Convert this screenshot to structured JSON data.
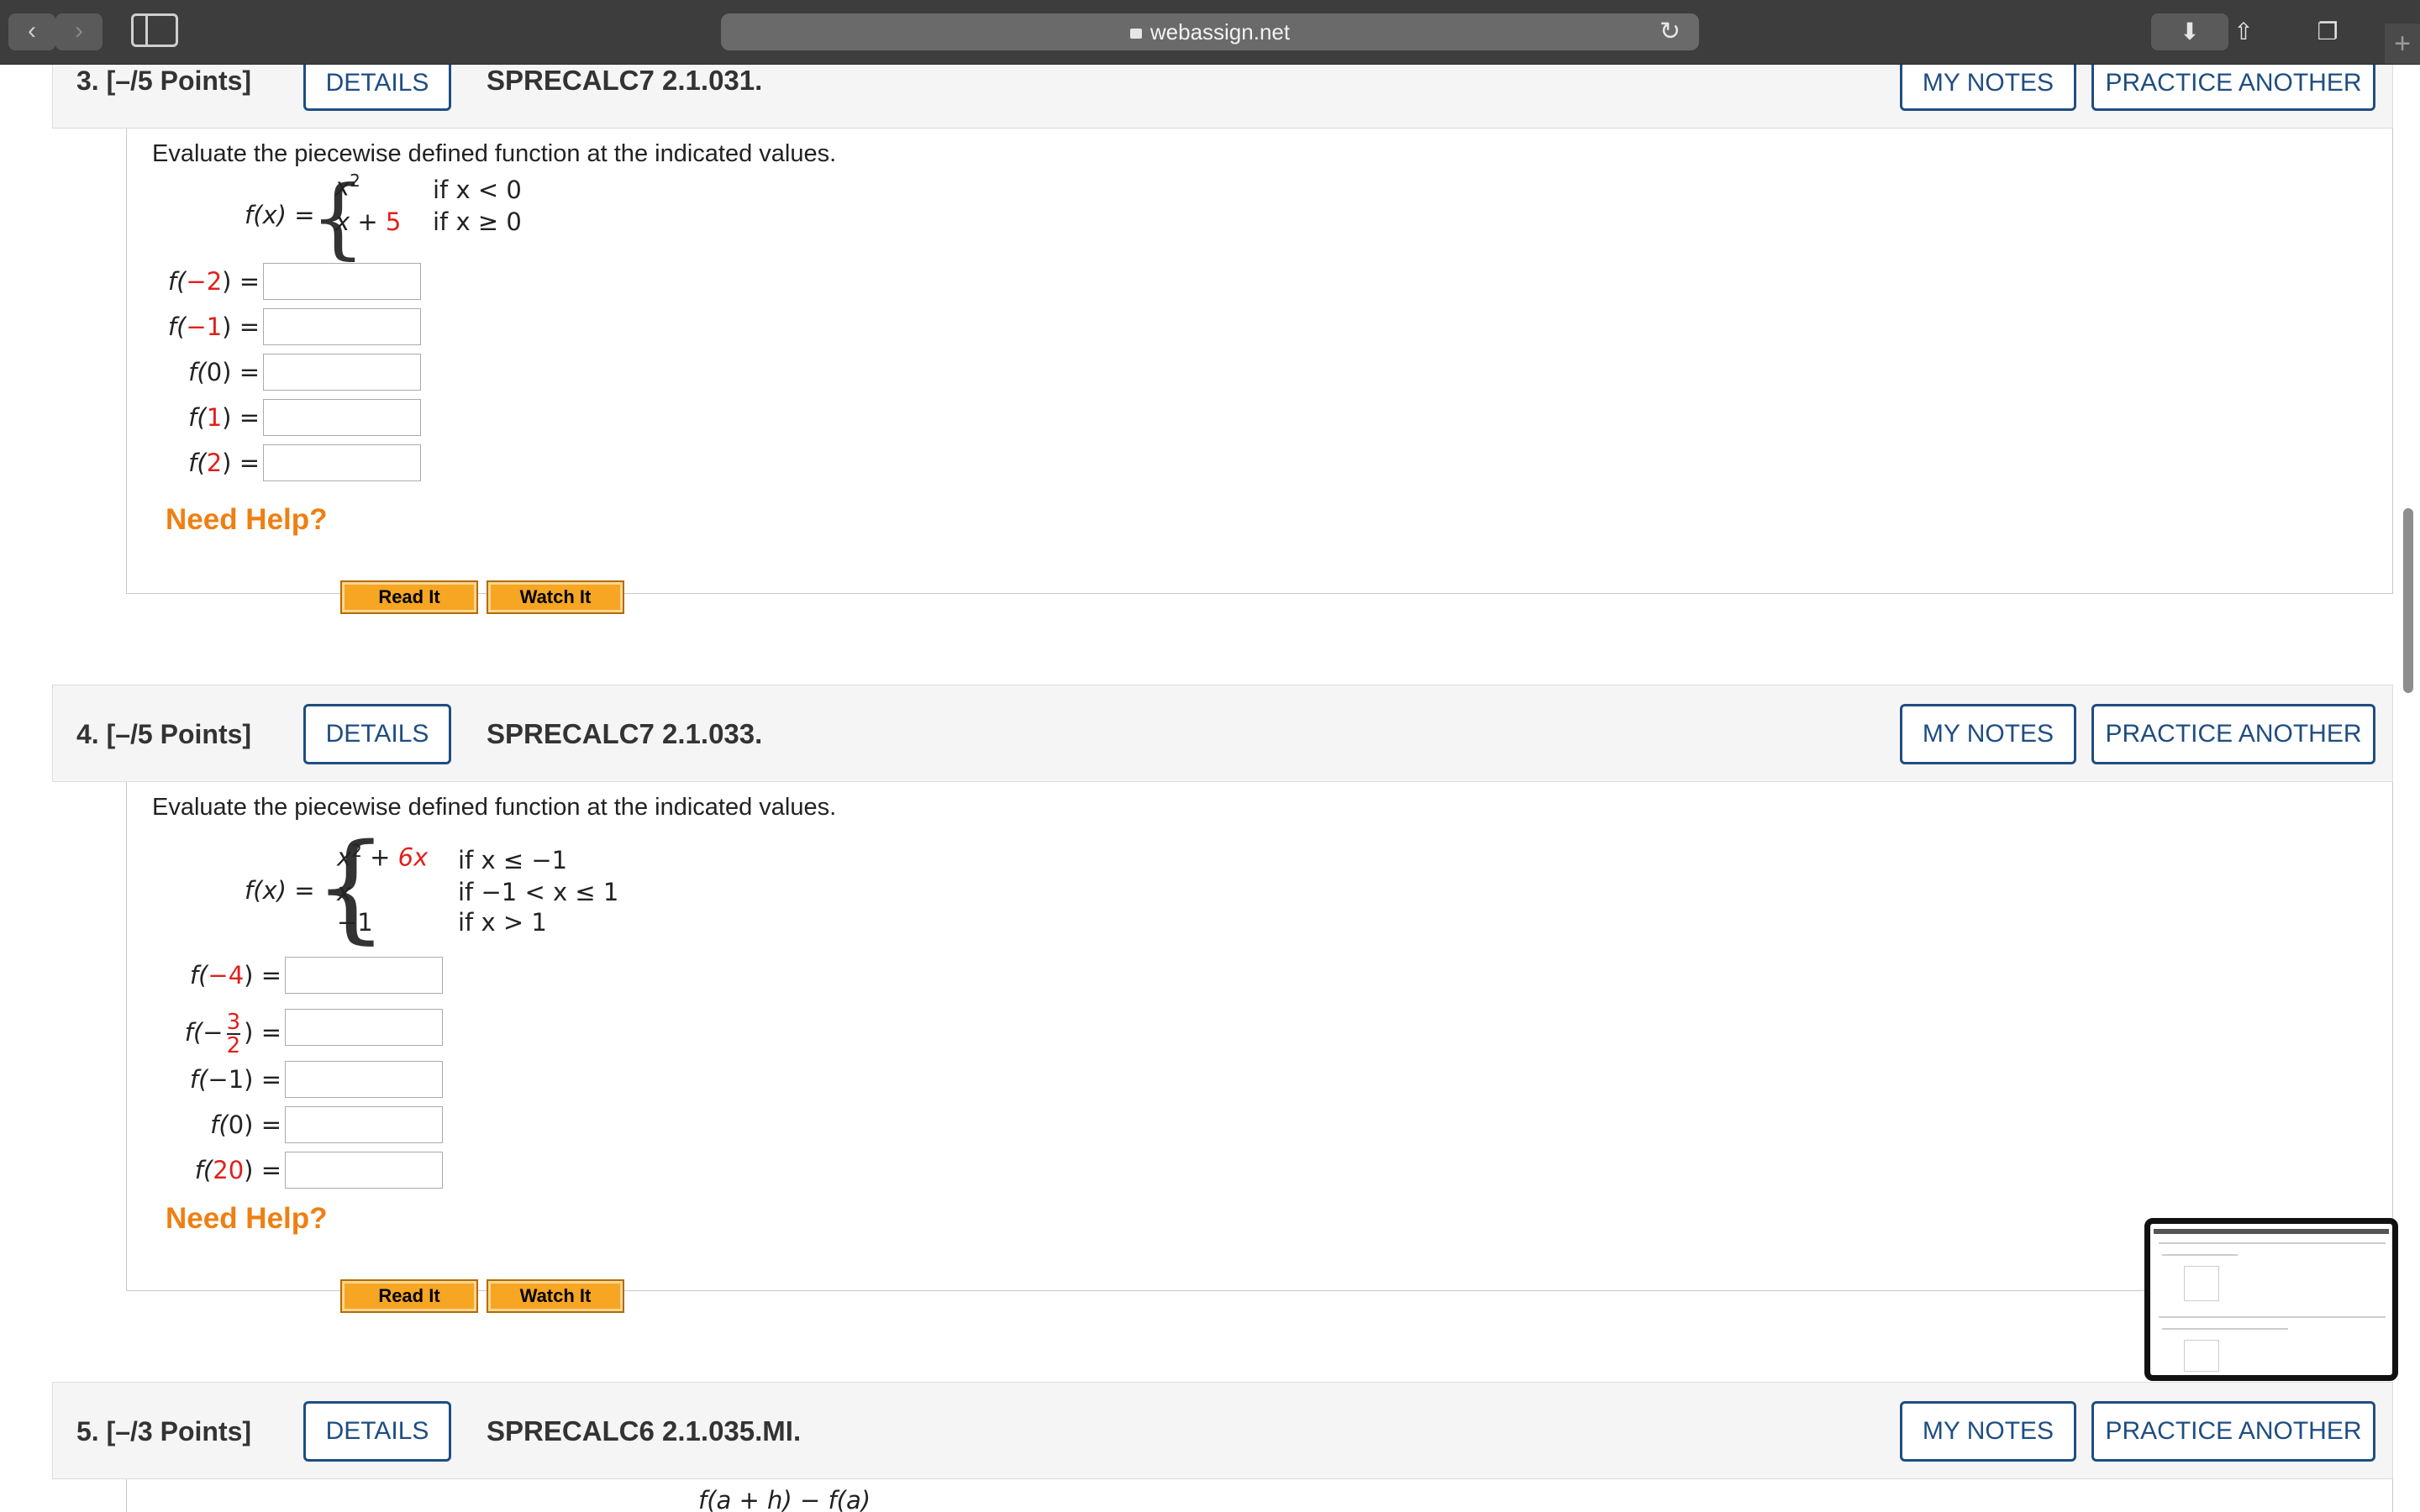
{
  "browser": {
    "url": "webassign.net",
    "back_icon": "‹",
    "forward_icon": "›",
    "reload_icon": "↻",
    "download_icon": "⬇",
    "share_icon": "⇧",
    "tabs_icon": "❐",
    "new_tab_icon": "+"
  },
  "labels": {
    "details": "DETAILS",
    "my_notes": "MY NOTES",
    "practice_another": "PRACTICE ANOTHER",
    "need_help": "Need Help?",
    "read_it": "Read It",
    "watch_it": "Watch It",
    "prompt": "Evaluate the piecewise defined function at the indicated values."
  },
  "q3": {
    "number": "3.",
    "points": "[–/5 Points]",
    "code": "SPRECALC7 2.1.031.",
    "fx": "f(x) =",
    "case1_expr": "x",
    "case1_exp": "2",
    "case1_cond": "if x < 0",
    "case2_expr": "x + ",
    "case2_const": "5",
    "case2_cond": "if x ≥ 0",
    "evals": [
      {
        "pre": "f(",
        "arg": "−2",
        "post": ") =",
        "value": ""
      },
      {
        "pre": "f(",
        "arg": "−1",
        "post": ") =",
        "value": ""
      },
      {
        "pre": "f(",
        "arg": "0",
        "post": ") =",
        "value": ""
      },
      {
        "pre": "f(",
        "arg": "1",
        "post": ") =",
        "value": ""
      },
      {
        "pre": "f(",
        "arg": "2",
        "post": ") =",
        "value": ""
      }
    ]
  },
  "q4": {
    "number": "4.",
    "points": "[–/5 Points]",
    "code": "SPRECALC7 2.1.033.",
    "fx": "f(x) =",
    "case1_expr": "x",
    "case1_exp": "2",
    "case1_plus": " + ",
    "case1_red": "6x",
    "case1_cond": "if x ≤ −1",
    "case2_expr": "x",
    "case2_cond": "if −1 < x ≤ 1",
    "case3_expr": "−1",
    "case3_cond": "if x > 1",
    "evals": [
      {
        "pre": "f(",
        "arg": "−4",
        "post": ") =",
        "value": ""
      },
      {
        "pre": "f(−",
        "num": "3",
        "den": "2",
        "post": ") =",
        "value": ""
      },
      {
        "pre": "f(",
        "arg": "−1",
        "post": ") =",
        "value": ""
      },
      {
        "pre": "f(",
        "arg": "0",
        "post": ") =",
        "value": ""
      },
      {
        "pre": "f(",
        "arg": "20",
        "post": ") =",
        "value": ""
      }
    ]
  },
  "q5": {
    "number": "5.",
    "points": "[–/3 Points]",
    "code": "SPRECALC6 2.1.035.MI.",
    "partial_text": "f(a + h) − f(a)"
  }
}
